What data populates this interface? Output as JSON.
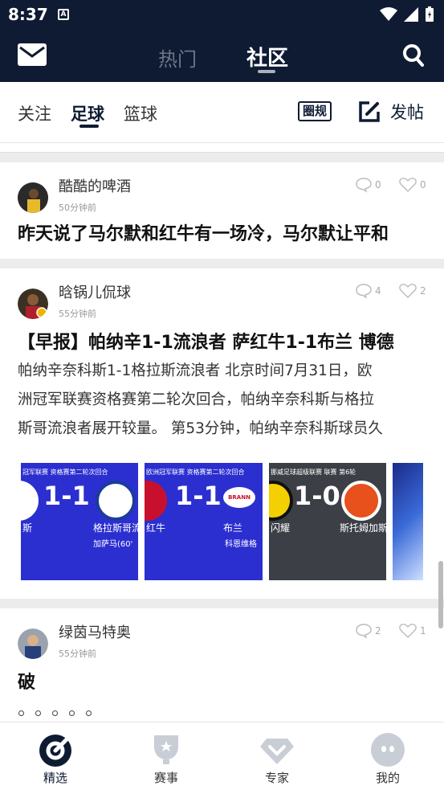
{
  "status_bar": {
    "time": "8:37",
    "badge": "A"
  },
  "header": {
    "tabs": [
      {
        "label": "热门"
      },
      {
        "label": "社区"
      }
    ]
  },
  "subtabs": {
    "items": [
      {
        "label": "关注"
      },
      {
        "label": "足球"
      },
      {
        "label": "篮球"
      }
    ],
    "active": "足球",
    "rules_label": "圈规",
    "post_label": "发帖"
  },
  "posts": [
    {
      "author": "酷酷的啤酒",
      "time": "50分钟前",
      "comments": "0",
      "likes": "0",
      "title": "昨天说了马尔默和红牛有一场冷，马尔默让平和"
    },
    {
      "author": "晗锅儿侃球",
      "time": "55分钟前",
      "comments": "4",
      "likes": "2",
      "title": "【早报】帕纳辛1-1流浪者 萨红牛1-1布兰 博德",
      "summary": [
        "帕纳辛奈科斯1-1格拉斯流浪者 北京时间7月31日，欧",
        "洲冠军联赛资格赛第二轮次回合，帕纳辛奈科斯与格拉",
        "斯哥流浪者展开较量。 第53分钟，帕纳辛奈科斯球员久"
      ],
      "images": [
        {
          "league": "冠军联赛 资格赛第二轮次回合",
          "score": "1-1",
          "team_left": "斯",
          "team_right": "格拉斯哥流",
          "scorer": "加萨马(60'"
        },
        {
          "league": "欧洲冠军联赛 资格赛第二轮次回合",
          "score": "1-1",
          "team_left": "红牛",
          "team_right": "布兰",
          "scorer": "科恩维格",
          "crest_label": "BRANN"
        },
        {
          "league": "挪威足球超级联赛 联赛 第6轮",
          "score": "1-0",
          "team_left": "闪耀",
          "team_right": "斯托姆加斯"
        }
      ]
    },
    {
      "author": "绿茵马特奥",
      "time": "55分钟前",
      "comments": "2",
      "likes": "1",
      "title": "破"
    }
  ],
  "bottom_nav": [
    {
      "label": "精选",
      "icon": "target-icon",
      "active": true
    },
    {
      "label": "赛事",
      "icon": "trophy-icon"
    },
    {
      "label": "专家",
      "icon": "diamond-icon"
    },
    {
      "label": "我的",
      "icon": "avatar-face-icon"
    }
  ],
  "colors": {
    "navy": "#0f1b33",
    "thumb_blue": "#2b2fd0",
    "thumb_dark": "#3c4046"
  }
}
